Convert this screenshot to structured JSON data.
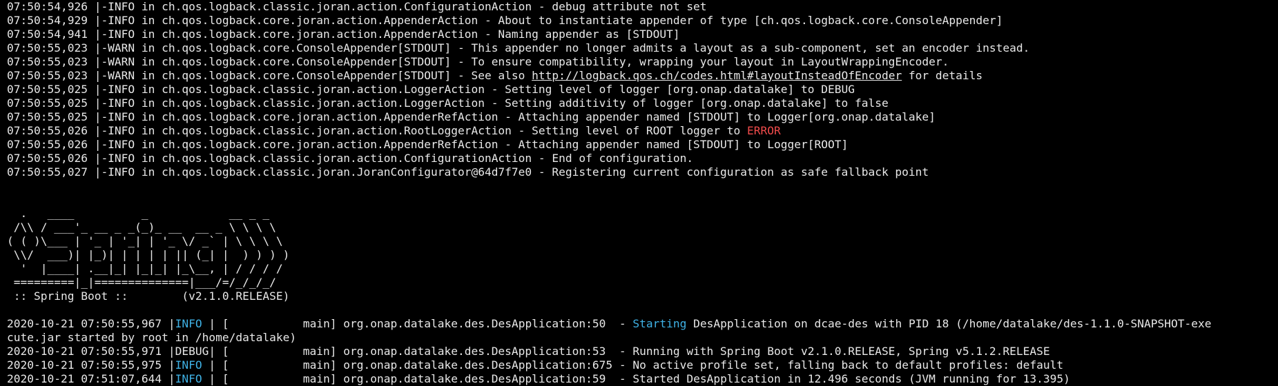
{
  "terminal": {
    "logback_lines": [
      {
        "pre": "07:50:54,926 |-INFO in ch.qos.logback.classic.joran.action.ConfigurationAction - debug attribute not set"
      },
      {
        "pre": "07:50:54,929 |-INFO in ch.qos.logback.core.joran.action.AppenderAction - About to instantiate appender of type [ch.qos.logback.core.ConsoleAppender]"
      },
      {
        "pre": "07:50:54,941 |-INFO in ch.qos.logback.core.joran.action.AppenderAction - Naming appender as [STDOUT]"
      },
      {
        "pre": "07:50:55,023 |-WARN in ch.qos.logback.core.ConsoleAppender[STDOUT] - This appender no longer admits a layout as a sub-component, set an encoder instead."
      },
      {
        "pre": "07:50:55,023 |-WARN in ch.qos.logback.core.ConsoleAppender[STDOUT] - To ensure compatibility, wrapping your layout in LayoutWrappingEncoder."
      },
      {
        "pre": "07:50:55,023 |-WARN in ch.qos.logback.core.ConsoleAppender[STDOUT] - See also ",
        "link": "http://logback.qos.ch/codes.html#layoutInsteadOfEncoder",
        "post": " for details"
      },
      {
        "pre": "07:50:55,025 |-INFO in ch.qos.logback.classic.joran.action.LoggerAction - Setting level of logger [org.onap.datalake] to DEBUG"
      },
      {
        "pre": "07:50:55,025 |-INFO in ch.qos.logback.classic.joran.action.LoggerAction - Setting additivity of logger [org.onap.datalake] to false"
      },
      {
        "pre": "07:50:55,025 |-INFO in ch.qos.logback.core.joran.action.AppenderRefAction - Attaching appender named [STDOUT] to Logger[org.onap.datalake]"
      },
      {
        "pre": "07:50:55,026 |-INFO in ch.qos.logback.classic.joran.action.RootLoggerAction - Setting level of ROOT logger to ",
        "red": "ERROR"
      },
      {
        "pre": "07:50:55,026 |-INFO in ch.qos.logback.core.joran.action.AppenderRefAction - Attaching appender named [STDOUT] to Logger[ROOT]"
      },
      {
        "pre": "07:50:55,026 |-INFO in ch.qos.logback.classic.joran.action.ConfigurationAction - End of configuration."
      },
      {
        "pre": "07:50:55,027 |-INFO in ch.qos.logback.classic.joran.JoranConfigurator@64d7f7e0 - Registering current configuration as safe fallback point"
      }
    ],
    "banner_lines": [
      "  .   ____          _            __ _ _",
      " /\\\\ / ___'_ __ _ _(_)_ __  __ _ \\ \\ \\ \\",
      "( ( )\\___ | '_ | '_| | '_ \\/ _` | \\ \\ \\ \\",
      " \\\\/  ___)| |_)| | | | | || (_| |  ) ) ) )",
      "  '  |____| .__|_| |_|_| |_\\__, | / / / /",
      " =========|_|==============|___/=/_/_/_/",
      " :: Spring Boot ::        (v2.1.0.RELEASE)"
    ],
    "app_lines": [
      {
        "pre": "2020-10-21 07:50:55,967 |",
        "level": "INFO ",
        "level_color": "cyan",
        "mid": "| [           main] org.onap.datalake.des.DesApplication:50  - ",
        "hl": "Starting",
        "post": " DesApplication on dcae-des with PID 18 (/home/datalake/des-1.1.0-SNAPSHOT-exe"
      },
      {
        "pre": "cute.jar started by root in /home/datalake)"
      },
      {
        "pre": "2020-10-21 07:50:55,971 |DEBUG| [           main] org.onap.datalake.des.DesApplication:53  - Running with Spring Boot v2.1.0.RELEASE, Spring v5.1.2.RELEASE"
      },
      {
        "pre": "2020-10-21 07:50:55,975 |",
        "level": "INFO ",
        "level_color": "cyan",
        "mid": "| [           main] org.onap.datalake.des.DesApplication:675 - No active profile set, falling back to default profiles: default"
      },
      {
        "pre": "2020-10-21 07:51:07,644 |",
        "level": "INFO ",
        "level_color": "cyan",
        "mid": "| [           main] org.onap.datalake.des.DesApplication:59  - Started DesApplication in 12.496 seconds (JVM running for 13.395)"
      }
    ],
    "colors": {
      "background": "#000000",
      "foreground": "#e8e8e8",
      "cyan": "#3fb2e6",
      "red": "#f04b4b"
    }
  }
}
